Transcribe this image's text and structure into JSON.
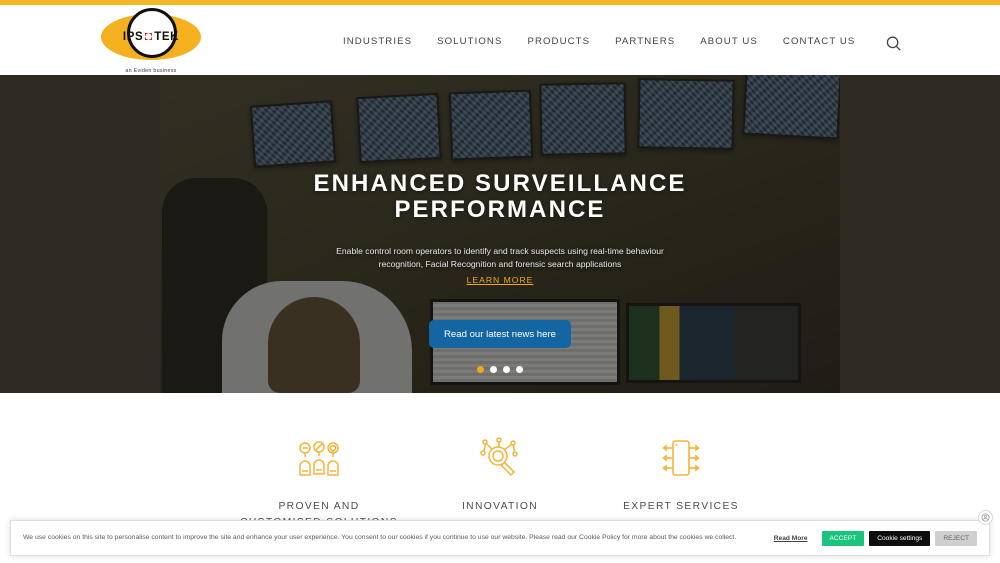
{
  "brand": {
    "logo_text_left": "IPS",
    "logo_text_right": "TEK",
    "logo_icon": "dashed-square-icon",
    "tagline": "an Eviden business",
    "accent_orange": "#f5b01f",
    "accent_red": "#d6232e"
  },
  "nav": {
    "items": [
      {
        "label": "INDUSTRIES"
      },
      {
        "label": "SOLUTIONS"
      },
      {
        "label": "PRODUCTS"
      },
      {
        "label": "PARTNERS"
      },
      {
        "label": "ABOUT US"
      },
      {
        "label": "CONTACT US"
      }
    ],
    "search_icon": "search-icon"
  },
  "hero": {
    "title": "ENHANCED SURVEILLANCE PERFORMANCE",
    "subtitle": "Enable control room operators to identify and track suspects using real-time behaviour recognition, Facial Recognition and forensic search applications",
    "learn_more": "LEARN MORE",
    "cta_label": "Read our latest news here",
    "cta_color": "#1366a1",
    "slides_total": 4,
    "active_slide": 1,
    "image_description": "control room operator at desk with wall of CCTV monitors"
  },
  "features": [
    {
      "icon": "people-group-icon",
      "title": "PROVEN AND\nCUSTOMISED SOLUTIONS"
    },
    {
      "icon": "magnifier-network-icon",
      "title": "INNOVATION"
    },
    {
      "icon": "microchip-icon",
      "title": "EXPERT SERVICES"
    }
  ],
  "cookie_banner": {
    "message": "We use cookies on this site to personalise content to improve the site and enhance your user experience. You consent to our cookies if you continue to use our website. Please read our Cookie Policy for more about the cookies we collect.",
    "read_more": "Read More",
    "accept_label": "ACCEPT",
    "settings_label": "Cookie settings",
    "reject_label": "REJECT",
    "accept_color": "#1bc47d",
    "close_icon": "close-badge-icon"
  }
}
